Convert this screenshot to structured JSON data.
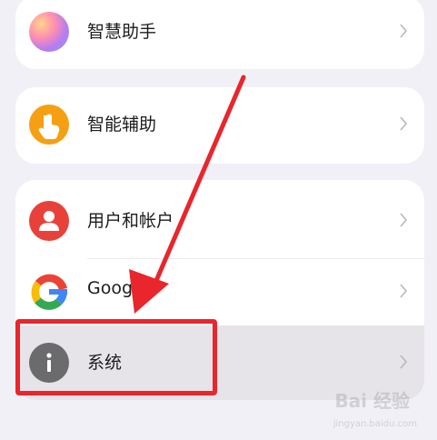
{
  "settings": {
    "items": [
      {
        "label": "智慧助手",
        "icon": "assistant-gradient-icon"
      },
      {
        "label": "智能辅助",
        "icon": "hand-tap-icon"
      },
      {
        "label": "用户和帐户",
        "icon": "user-icon"
      },
      {
        "label": "Google",
        "icon": "google-icon"
      },
      {
        "label": "系统",
        "icon": "info-icon"
      }
    ]
  },
  "watermark": {
    "brand": "Bai 经验",
    "url": "jingyan.baidu.com"
  },
  "colors": {
    "background": "#f1f0f6",
    "card": "#ffffff",
    "highlight_row": "#e6e4e8",
    "annotation_red": "#e8262c",
    "assist_orange": "#f5a012",
    "user_red": "#e8413a",
    "info_gray": "#6b6b6e"
  }
}
